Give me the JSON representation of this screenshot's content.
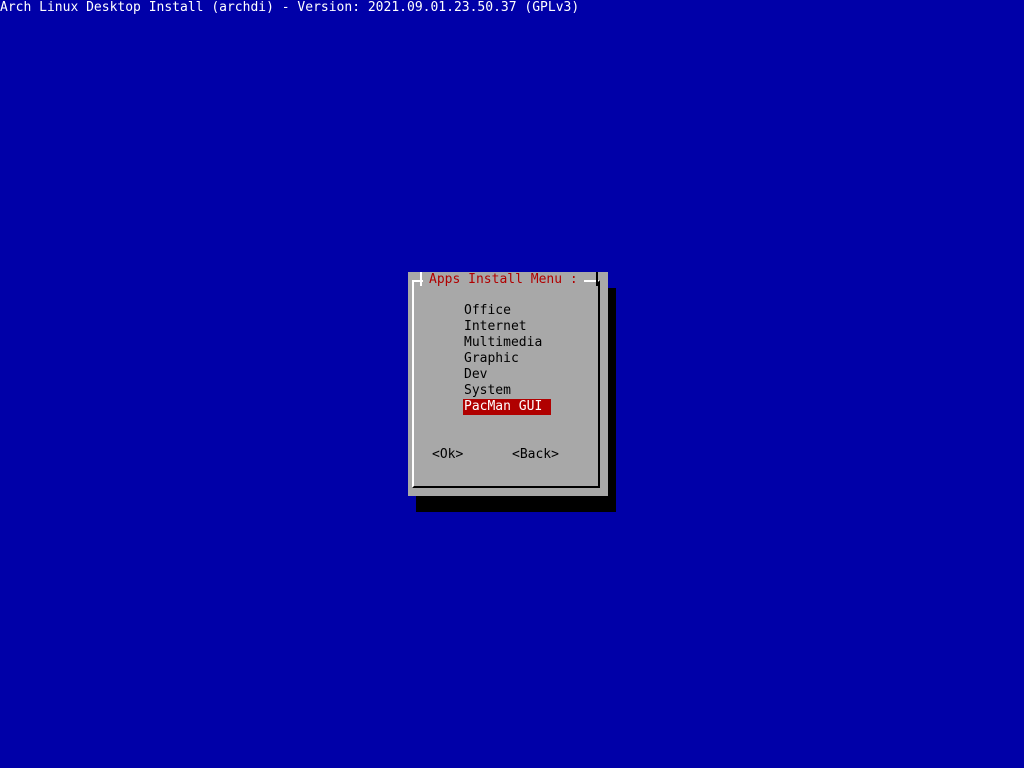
{
  "backtitle": "Arch Linux Desktop Install (archdi) - Version: 2021.09.01.23.50.37 (GPLv3)",
  "dialog": {
    "title": "Apps Install Menu :",
    "menu_items": [
      {
        "label": "Office",
        "selected": false
      },
      {
        "label": "Internet",
        "selected": false
      },
      {
        "label": "Multimedia",
        "selected": false
      },
      {
        "label": "Graphic",
        "selected": false
      },
      {
        "label": "Dev",
        "selected": false
      },
      {
        "label": "System",
        "selected": false
      },
      {
        "label": "PacMan GUI",
        "selected": true
      }
    ],
    "buttons": {
      "ok_label": "<Ok>",
      "back_label": "<Back>"
    }
  },
  "colors": {
    "background": "#0000a8",
    "dialog": "#a8a8a8",
    "highlight": "#b00000",
    "title_text": "#b00000"
  }
}
